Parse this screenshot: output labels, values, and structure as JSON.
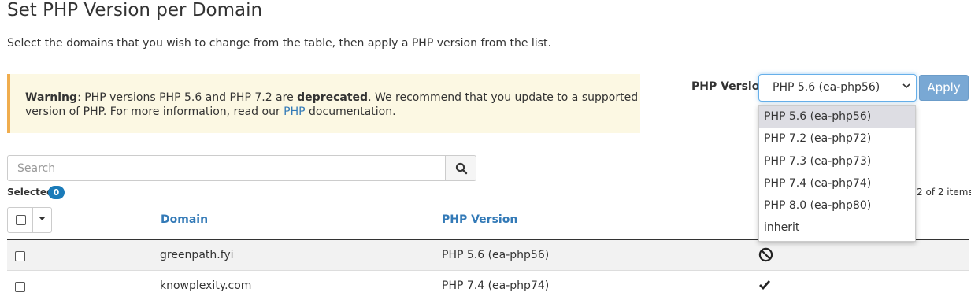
{
  "page": {
    "title": "Set PHP Version per Domain",
    "intro": "Select the domains that you wish to change from the table, then apply a PHP version from the list."
  },
  "warning": {
    "label": "Warning",
    "text_before": ": PHP versions PHP 5.6 and PHP 7.2 are ",
    "bold": "deprecated",
    "text_after": ". We recommend that you update to a supported version of PHP. For more information, read our ",
    "link": "PHP",
    "text_end": " documentation.",
    "bg_color": "#fcf8e3",
    "border_color": "#f0ad4e"
  },
  "php_control": {
    "label": "PHP Version",
    "selected": "PHP 5.6 (ea-php56)",
    "apply_label": "Apply",
    "options": [
      "PHP 5.6 (ea-php56)",
      "PHP 7.2 (ea-php72)",
      "PHP 7.3 (ea-php73)",
      "PHP 7.4 (ea-php74)",
      "PHP 8.0 (ea-php80)",
      "inherit"
    ]
  },
  "search": {
    "placeholder": "Search",
    "icon": "search-icon"
  },
  "selection": {
    "label": "Selected",
    "count": "0",
    "items_count": "2 of 2 items"
  },
  "table": {
    "columns": [
      "Domain",
      "PHP Version"
    ],
    "rows": [
      {
        "domain": "greenpath.fyi",
        "php_version": "PHP 5.6 (ea-php56)",
        "status_icon": "ban-icon"
      },
      {
        "domain": "knowplexity.com",
        "php_version": "PHP 7.4 (ea-php74)",
        "status_icon": "check-icon"
      }
    ]
  },
  "colors": {
    "link": "#337ab7",
    "apply_button": "#79a8d4",
    "badge": "#1a7bb9"
  }
}
